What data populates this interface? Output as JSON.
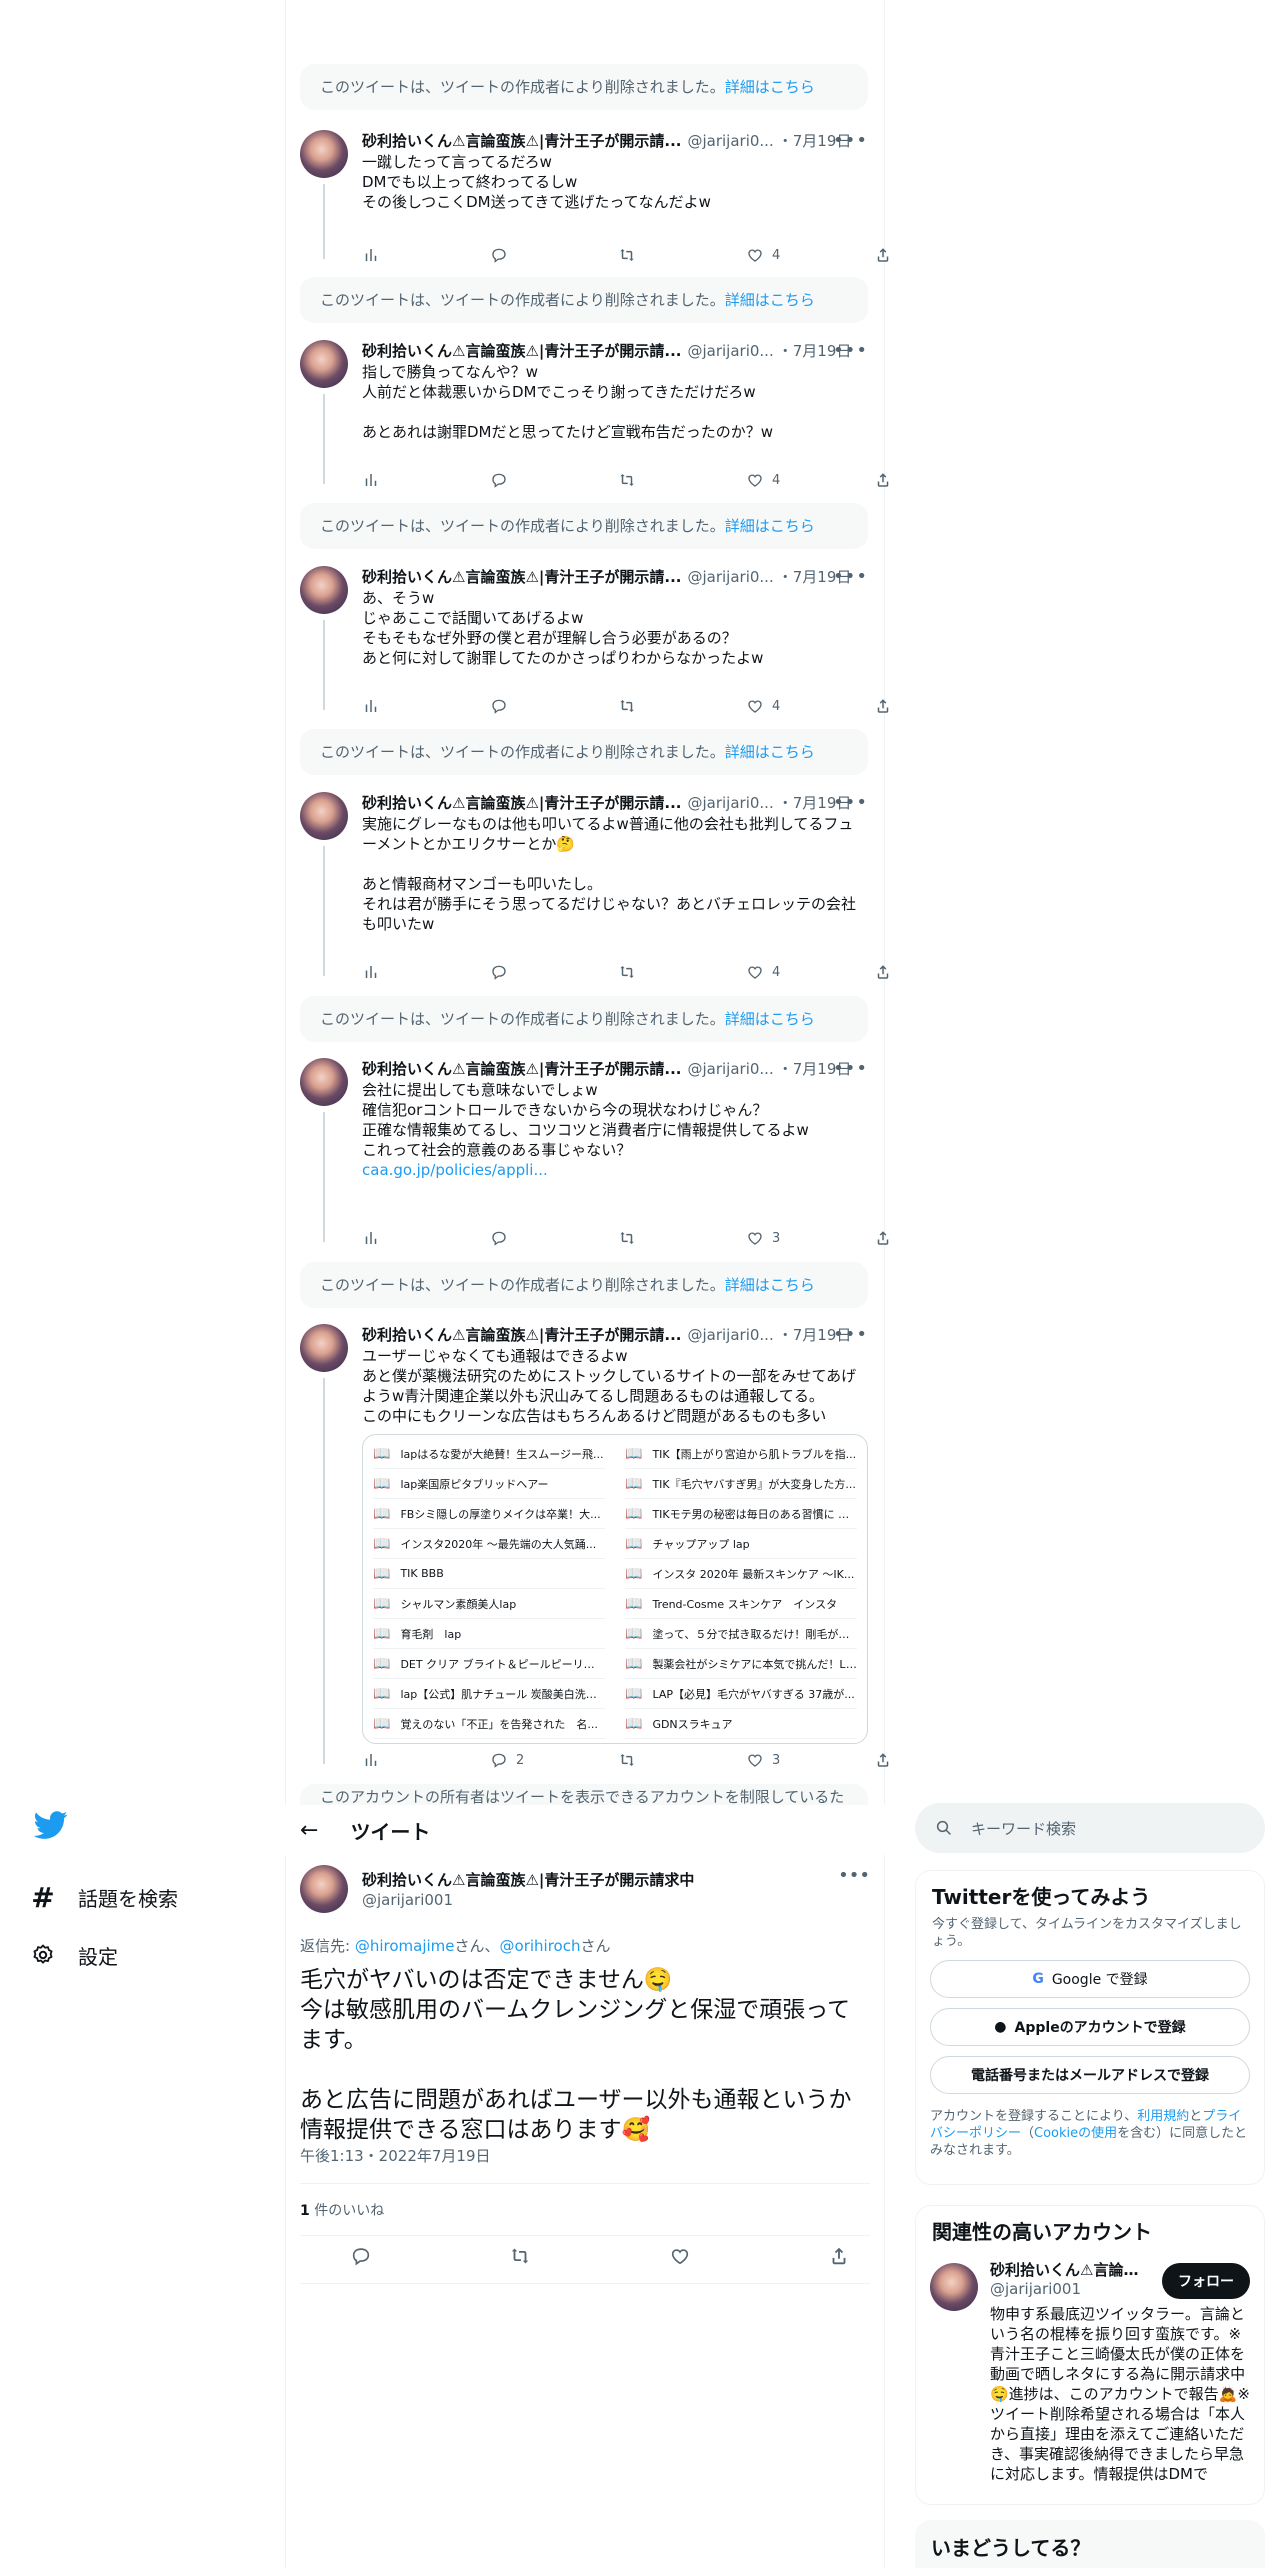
{
  "nav": {
    "items": [
      {
        "label": "話題を検索",
        "icon": "hashtag-icon"
      },
      {
        "label": "設定",
        "icon": "gear-icon"
      }
    ]
  },
  "tombstone": {
    "text": "このツイートは、ツイートの作成者により削除されました。",
    "link": "詳細はこちら"
  },
  "author": {
    "name": "砂利拾いくん⚠言論蛮族⚠|青汁王子が開示請...",
    "handle": "@jarijari0...",
    "date": "・7月19日"
  },
  "tweets": [
    {
      "text": "一蹴したって言ってるだろw\nDMでも以上って終わってるしw\nその後しつこくDM送ってきて逃げたってなんだよw",
      "likes": "4"
    },
    {
      "text": "指しで勝負ってなんや？w\n人前だと体裁悪いからDMでこっそり謝ってきただけだろw\n\nあとあれは謝罪DMだと思ってたけど宣戦布告だったのか？w",
      "likes": "4"
    },
    {
      "text": "あ、そうw\nじゃあここで話聞いてあげるよw\nそもそもなぜ外野の僕と君が理解し合う必要があるの？\nあと何に対して謝罪してたのかさっぱりわからなかったよw",
      "likes": "4"
    },
    {
      "text": "実施にグレーなものは他も叩いてるよw普通に他の会社も批判してるフューメントとかエリクサーとか🤔\n\nあと情報商材マンゴーも叩いたし。\nそれは君が勝手にそう思ってるだけじゃない？あとバチェロレッテの会社も叩いたw",
      "likes": "4"
    },
    {
      "text": "会社に提出しても意味ないでしょw\n確信犯orコントロールできないから今の現状なわけじゃん？\n正確な情報集めてるし、コツコツと消費者庁に情報提供してるよw\nこれって社会的意義のある事じゃない？\n",
      "link": "caa.go.jp/policies/appli...",
      "likes": "3"
    },
    {
      "text": "ユーザーじゃなくても通報はできるよw\nあと僕が薬機法研究のためにストックしているサイトの一部をみせてあげようw青汁関連企業以外も沢山みてるし問題あるものは通報してる。\nこの中にもクリーンな広告はもちろんあるけど問題があるものも多い",
      "likes": "3",
      "replies": "2"
    }
  ],
  "bookmarks": {
    "left": [
      "lapはるな愛が大絶賛！生スムージー飛...",
      "lap楽国原ピタブリッドヘアー",
      "FBシミ隠しの厚塗りメイクは卒業！大...",
      "インスタ2020年 〜最先端の大人気踊...",
      "TIK BBB",
      "シャルマン素顔美人lap",
      "育毛剤　lap",
      "DET クリア ブライト＆ピールピーリン...",
      "lap【公式】肌ナチュール 炭酸美白洗顔...",
      "覚えのない「不正」を告発された　名..."
    ],
    "right": [
      "TIK【雨上がり宮迫から肌トラブルを指...",
      "TIK『毛穴ヤバすぎ男』が大変身した方...",
      "TIKモテ男の秘密は毎日のある習慣に あ...",
      "チャップアップ lap",
      "インスタ 2020年 最新スキンケア 〜IK...",
      "Trend-Cosme スキンケア　インスタ",
      "塗って、５分で拭き取るだけ！剛毛が➔...",
      "製薬会社がシミケアに本気で挑んだ！LAP",
      "LAP【必見】毛穴がヤバすぎる 37歳が...",
      "GDNスラキュア"
    ]
  },
  "cutoff_text": "このアカウントの所有者はツイートを表示できるアカウントを制限しているた",
  "page_header": {
    "title": "ツイート"
  },
  "main_tweet": {
    "name": "砂利拾いくん⚠言論蛮族⚠|青汁王子が開示請求中",
    "handle": "@jarijari001",
    "reply_prefix": "返信先: ",
    "reply_to_1": "@hiromajime",
    "reply_mid": "さん、",
    "reply_to_2": "@orihiroch",
    "reply_suffix": "さん",
    "text": "毛穴がヤバいのは否定できません🤤\n今は敏感肌用のバームクレンジングと保湿で頑張ってます。\n\nあと広告に問題があればユーザー以外も通報というか情報提供できる窓口はあります🥰",
    "meta": "午後1:13・2022年7月19日",
    "likes_count": "1",
    "likes_label": " 件のいいね"
  },
  "sidebar": {
    "search_placeholder": "キーワード検索",
    "signup_title": "Twitterを使ってみよう",
    "signup_sub": "今すぐ登録して、タイムラインをカスタマイズしましょう。",
    "google": "Google で登録",
    "apple": "Appleのアカウントで登録",
    "phone": "電話番号またはメールアドレスで登録",
    "legal_1": "アカウントを登録することにより、",
    "legal_link1": "利用規約",
    "legal_2": "と",
    "legal_link2": "プライバシーポリシー",
    "legal_3": "（",
    "legal_link3": "Cookieの使用",
    "legal_4": "を含む）に同意したとみなされます。",
    "related_title": "関連性の高いアカウント",
    "related_name": "砂利拾いくん⚠言論...",
    "related_handle": "@jarijari001",
    "follow": "フォロー",
    "related_bio": "物申す系最底辺ツイッタラー。言論という名の棍棒を振り回す蛮族です。※青汁王子こと三崎優太氏が僕の正体を動画で晒しネタにする為に開示請求中🤤進捗は、このアカウントで報告🙇※ツイート削除希望される場合は「本人から直接」理由を添えてご連絡いただき、事実確認後納得できましたら早急に対応します。情報提供はDMで",
    "trend_title": "いまどうしてる？"
  }
}
